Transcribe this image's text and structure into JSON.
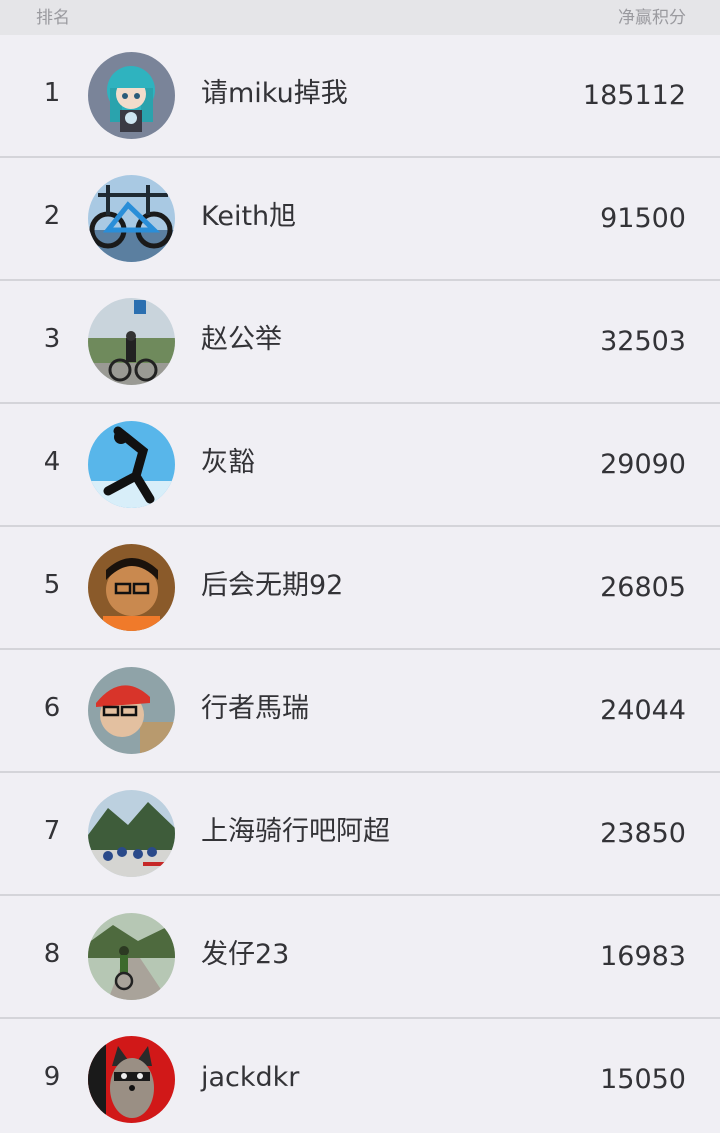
{
  "header": {
    "rank_label": "排名",
    "score_label": "净赢积分"
  },
  "rows": [
    {
      "rank": "1",
      "name": "请miku掉我",
      "score": "185112",
      "avatar_icon": "anime-figure-avatar"
    },
    {
      "rank": "2",
      "name": "Keith旭",
      "score": "91500",
      "avatar_icon": "bicycle-avatar"
    },
    {
      "rank": "3",
      "name": "赵公举",
      "score": "32503",
      "avatar_icon": "cyclist-avatar"
    },
    {
      "rank": "4",
      "name": "灰豁",
      "score": "29090",
      "avatar_icon": "jumping-person-avatar"
    },
    {
      "rank": "5",
      "name": "后会无期92",
      "score": "26805",
      "avatar_icon": "selfie-avatar"
    },
    {
      "rank": "6",
      "name": "行者馬瑞",
      "score": "24044",
      "avatar_icon": "helmet-selfie-avatar"
    },
    {
      "rank": "7",
      "name": "上海骑行吧阿超",
      "score": "23850",
      "avatar_icon": "group-ride-avatar"
    },
    {
      "rank": "8",
      "name": "发仔23",
      "score": "16983",
      "avatar_icon": "road-cyclist-avatar"
    },
    {
      "rank": "9",
      "name": "jackdkr",
      "score": "15050",
      "avatar_icon": "raccoon-avatar"
    }
  ]
}
